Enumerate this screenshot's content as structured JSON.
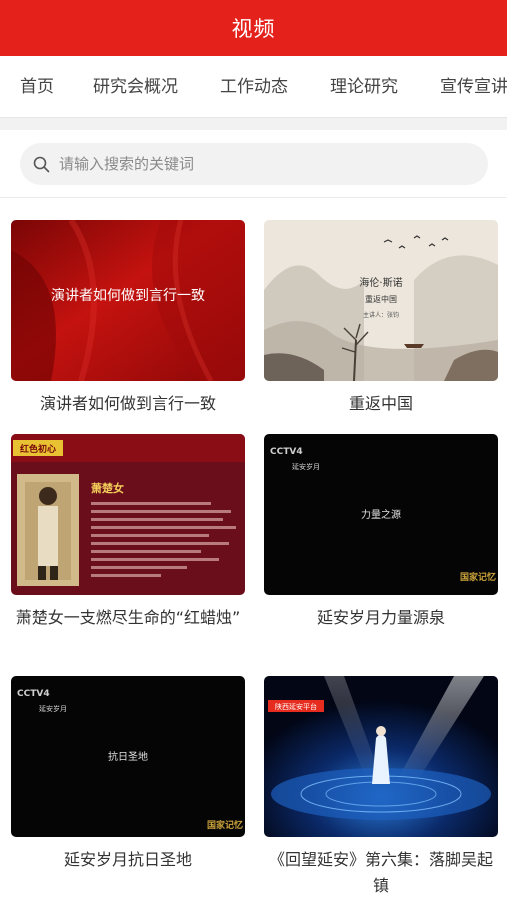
{
  "header": {
    "title": "视频"
  },
  "tabs": [
    {
      "label": "首页"
    },
    {
      "label": "研究会概况"
    },
    {
      "label": "工作动态"
    },
    {
      "label": "理论研究"
    },
    {
      "label": "宣传宣讲"
    }
  ],
  "search": {
    "placeholder": "请输入搜索的关键词",
    "icon": "search-icon"
  },
  "videos": [
    {
      "title": "演讲者如何做到言行一致",
      "thumb_text": "演讲者如何做到言行一致"
    },
    {
      "title": "重返中国",
      "thumb_text": "海伦·斯诺",
      "thumb_sub": "重返中国",
      "thumb_credit": "主讲人：张钧"
    },
    {
      "title": "萧楚女一支燃尽生命的“红蜡烛”",
      "thumb_badge": "红色初心",
      "thumb_name": "萧楚女"
    },
    {
      "title": "延安岁月力量源泉",
      "thumb_logo": "CCTV4",
      "thumb_series": "延安岁月",
      "thumb_text": "力量之源",
      "thumb_corner": "国家记忆"
    },
    {
      "title": "延安岁月抗日圣地",
      "thumb_logo": "CCTV4",
      "thumb_series": "延安岁月",
      "thumb_text": "抗日圣地",
      "thumb_corner": "国家记忆"
    },
    {
      "title": "《回望延安》第六集：落脚吴起镇",
      "thumb_badge": "陕西延安平台"
    }
  ],
  "colors": {
    "brand": "#e4211b"
  }
}
